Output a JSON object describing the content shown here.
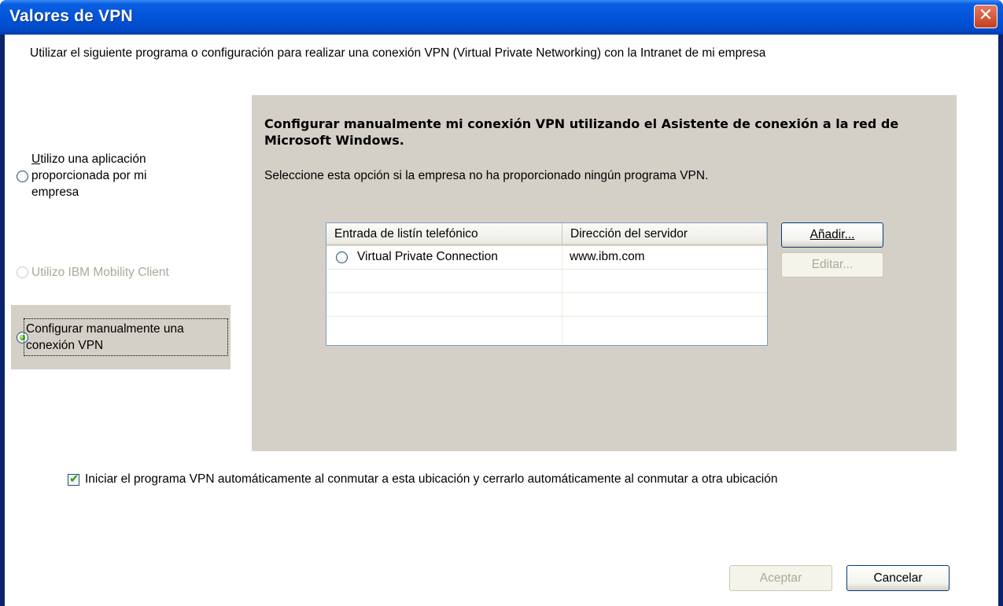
{
  "window": {
    "title": "Valores de VPN",
    "close_glyph": "✕",
    "colors": {
      "titlebar": "#0254d9",
      "panel": "#d4d0c8",
      "radio_checked": "#48b51b"
    }
  },
  "intro_text": "Utilizar el siguiente programa o configuración para realizar una conexión VPN (Virtual Private Networking) con la Intranet de mi empresa",
  "options": [
    {
      "label_lines": [
        "Utilizo una aplicación",
        "proporcionada por mi",
        "empresa"
      ],
      "checked": false,
      "enabled": true
    },
    {
      "label_lines": [
        "Utilizo IBM Mobility Client"
      ],
      "checked": false,
      "enabled": false
    },
    {
      "label_lines": [
        "Configurar manualmente una",
        "conexión VPN"
      ],
      "checked": true,
      "enabled": true
    }
  ],
  "panel": {
    "heading": "Configurar manualmente mi conexión VPN utilizando el Asistente de conexión a la red de Microsoft Windows.",
    "description": "Seleccione esta opción si la empresa no ha proporcionado ningún programa VPN.",
    "table": {
      "columns": [
        "Entrada de listín telefónico",
        "Dirección del servidor"
      ],
      "rows": [
        {
          "entry": "Virtual Private Connection",
          "server": "www.ibm.com",
          "selected": false
        }
      ]
    },
    "buttons": {
      "add": "Añadir...",
      "edit": "Editar..."
    }
  },
  "auto_start": {
    "checked": true,
    "label": "Iniciar el programa VPN automáticamente al conmutar a esta ubicación y cerrarlo automáticamente al conmutar a otra ubicación"
  },
  "footer": {
    "accept": "Aceptar",
    "cancel": "Cancelar"
  }
}
